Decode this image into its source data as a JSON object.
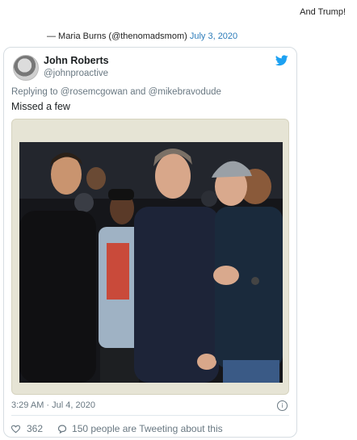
{
  "header": {
    "quote_text": "And Trump!"
  },
  "attribution": {
    "author": "— Maria Burns (@thenomadsmom)",
    "date": "July 3, 2020"
  },
  "tweet": {
    "name": "John Roberts",
    "handle": "@johnproactive",
    "replying_prefix": "Replying to",
    "reply_mention_1": "@rosemcgowan",
    "reply_and": "and",
    "reply_mention_2": "@mikebravodude",
    "text": "Missed a few",
    "timestamp": "3:29 AM · Jul 4, 2020",
    "likes": "362",
    "discussion": "150 people are Tweeting about this"
  },
  "icons": [
    "twitter-bird-icon",
    "info-icon",
    "heart-icon",
    "speech-bubble-icon"
  ],
  "colors": {
    "link": "#2b7bb9",
    "twitter_blue": "#1da1f2",
    "muted": "#697882",
    "media_bg": "#e6e4d5"
  }
}
